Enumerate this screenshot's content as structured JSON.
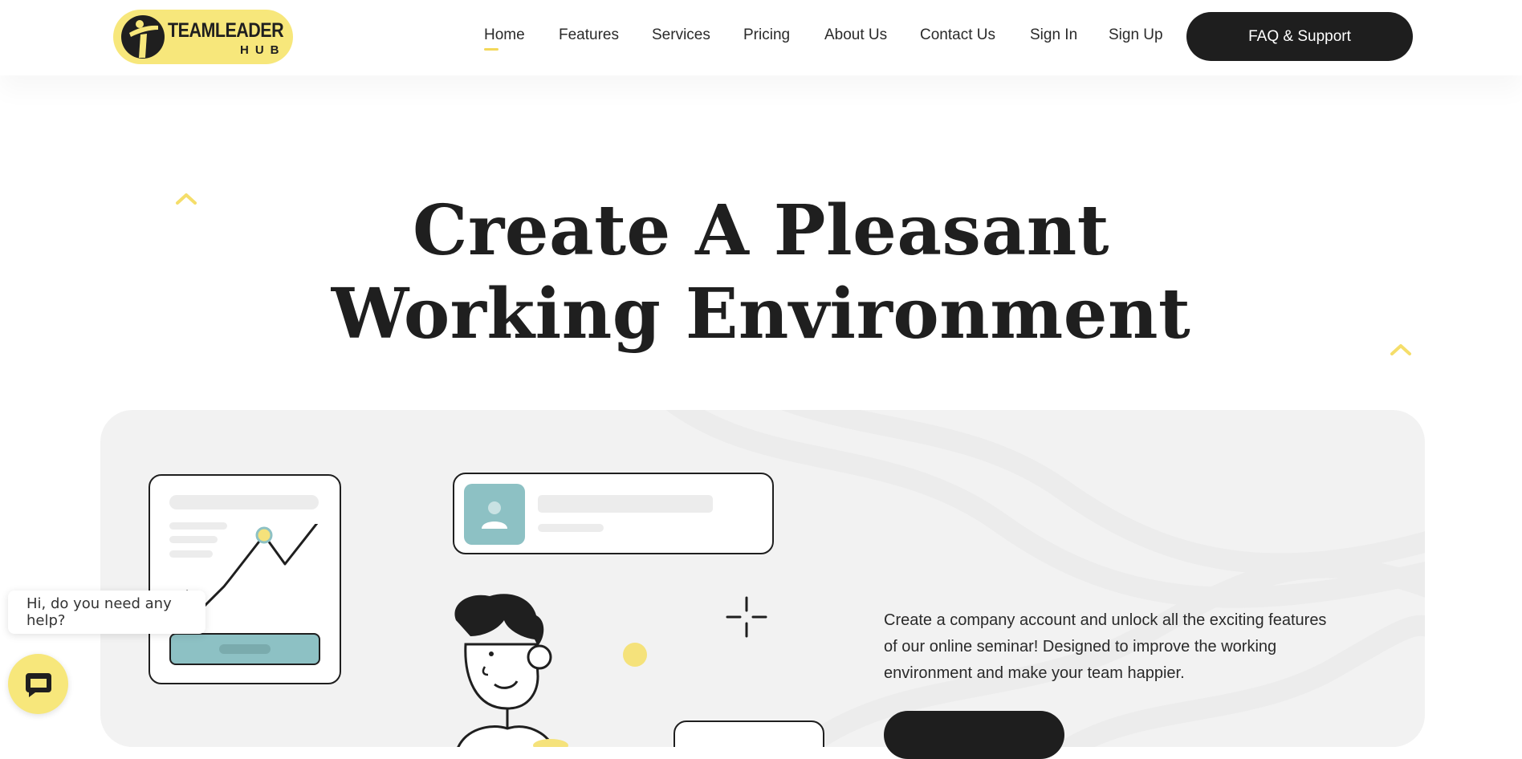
{
  "brand": {
    "line1": "TEAMLEADER",
    "line2": "HUB",
    "accent_color": "#f7e77b"
  },
  "nav": {
    "items": [
      {
        "label": "Home",
        "active": true
      },
      {
        "label": "Features"
      },
      {
        "label": "Services"
      },
      {
        "label": "Pricing"
      },
      {
        "label": "About Us"
      },
      {
        "label": "Contact Us"
      },
      {
        "label": "Sign In"
      },
      {
        "label": "Sign Up"
      }
    ],
    "cta_label": "FAQ & Support"
  },
  "hero": {
    "title_line1": "Create A Pleasant",
    "title_line2": "Working Environment"
  },
  "panel": {
    "description": "Create a company account and unlock all the exciting features of our online seminar! Designed to improve the working environment and make your team happier.",
    "colors": {
      "teal": "#8dc1c4",
      "yellow": "#f5e27b",
      "ink": "#1f1f1f"
    }
  },
  "chat": {
    "greeting": "Hi, do you need any help?",
    "icon": "chat-icon"
  },
  "icons": [
    "logo-mark-icon",
    "chevron-up-icon",
    "user-avatar-icon",
    "sparkle-icon",
    "chat-icon"
  ]
}
